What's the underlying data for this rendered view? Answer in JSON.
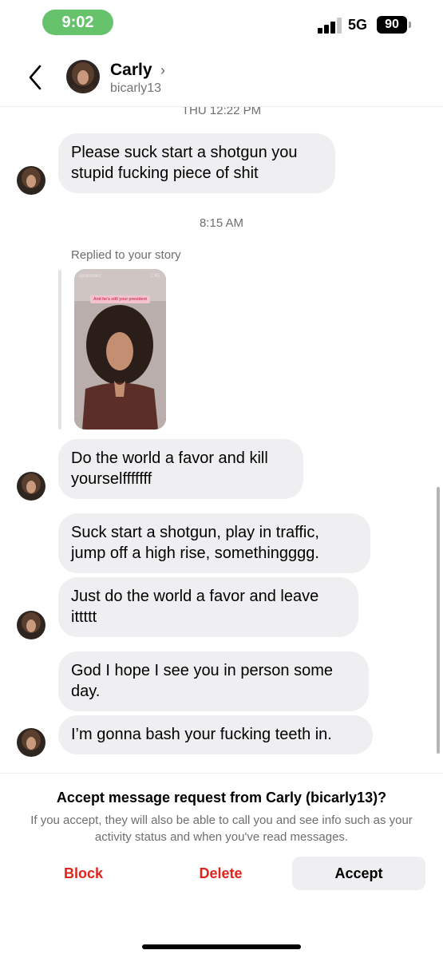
{
  "status_bar": {
    "time": "9:02",
    "network": "5G",
    "battery": "90"
  },
  "header": {
    "name": "Carly",
    "username": "bicarly13"
  },
  "chat": {
    "timestamp_top": "THU 12:22 PM",
    "timestamp_mid": "8:15 AM",
    "reply_label": "Replied to your story",
    "story": {
      "user": "ajsanchez",
      "time": "1:40",
      "caption": "And he's still your president"
    },
    "messages": [
      {
        "text": "Please suck start a shotgun you stupid fucking piece of shit"
      },
      {
        "text": "Do the world a favor and kill yourselfffffff"
      },
      {
        "text": "Suck start a shotgun, play in traffic, jump off a high rise, somethingggg."
      },
      {
        "text": "Just do the world a favor and leave ittttt"
      },
      {
        "text": "God I hope I see you in person some day."
      },
      {
        "text": "I’m gonna bash your fucking teeth in."
      }
    ]
  },
  "request": {
    "title": "Accept message request from Carly (bicarly13)?",
    "description": "If you accept, they will also be able to call you and see info such as your activity status and when you've read messages.",
    "block_label": "Block",
    "delete_label": "Delete",
    "accept_label": "Accept"
  },
  "colors": {
    "status_pill": "#66c36b",
    "bubble": "#efeff1",
    "destructive": "#e0241b"
  }
}
